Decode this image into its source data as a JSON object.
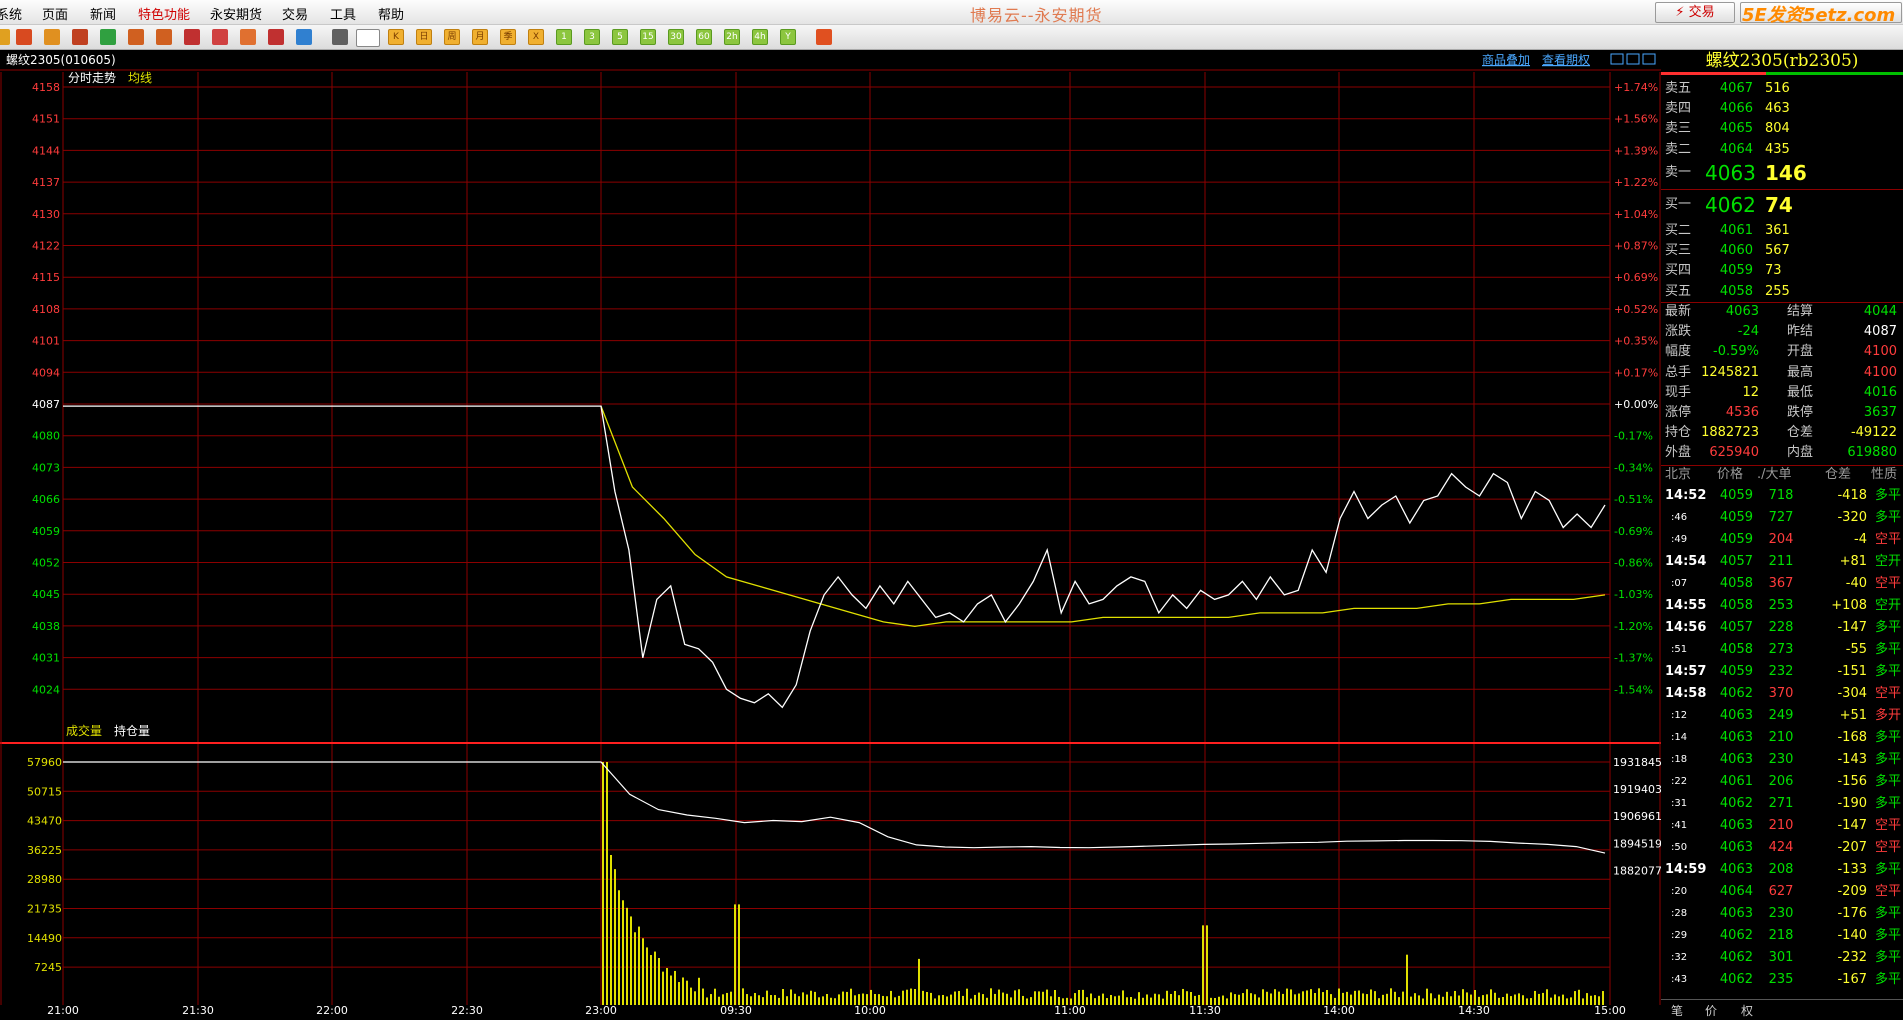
{
  "menu": {
    "items": [
      "系统",
      "页面",
      "新闻",
      "特色功能",
      "永安期货",
      "交易",
      "工具",
      "帮助"
    ],
    "highlight_index": 3
  },
  "app_title": "博易云--永安期货",
  "trade_button": "⚡ 交易",
  "watermark": "5E发资5etz.com",
  "toolbar": {
    "icons": [
      "home-icon",
      "folder-icon",
      "news-icon",
      "refresh-icon",
      "zoom-in-icon",
      "zoom-out-icon",
      "window-icon",
      "draw-icon",
      "tool-icon",
      "filter-icon",
      "new-icon",
      "table-icon",
      "chart-icon",
      "kline-icon",
      "day-icon",
      "week-icon",
      "month-icon",
      "quarter-icon",
      "year-icon",
      "1min-icon",
      "3min-icon",
      "5min-icon",
      "15min-icon",
      "30min-icon",
      "60min-icon",
      "2h-icon",
      "4h-icon",
      "calc-icon"
    ],
    "labels": {
      "day": "日",
      "week": "周",
      "month": "月",
      "quarter": "季",
      "year": "年",
      "x": "X",
      "m1": "1",
      "m3": "3",
      "m5": "5",
      "m15": "15",
      "m30": "30",
      "m60": "60",
      "h2": "2h",
      "h4": "4h",
      "y": "Y"
    }
  },
  "chart": {
    "symbol_header": "螺纹2305(010605)",
    "links": [
      "商品叠加",
      "查看期权"
    ],
    "price_panel": {
      "title": "分时走势",
      "ma_label": "均线"
    },
    "volume_panel": {
      "title": "成交量",
      "oi_label": "持仓量"
    },
    "colors": {
      "price_line": "#ffffff",
      "avg_line": "#e0e000",
      "grid": "#8b0000",
      "volume_bars": "#e0e000",
      "up": "#ff3c3c",
      "down": "#00e000"
    }
  },
  "chart_data": {
    "type": "line",
    "price_axis_left": [
      "4158",
      "4151",
      "4144",
      "4137",
      "4130",
      "4122",
      "4115",
      "4108",
      "4101",
      "4094",
      "4087",
      "4080",
      "4073",
      "4066",
      "4059",
      "4052",
      "4045",
      "4038",
      "4031",
      "4024"
    ],
    "price_axis_right": [
      "+1.74%",
      "+1.56%",
      "+1.39%",
      "+1.22%",
      "+1.04%",
      "+0.87%",
      "+0.69%",
      "+0.52%",
      "+0.35%",
      "+0.17%",
      "+0.00%",
      "-0.17%",
      "-0.34%",
      "-0.51%",
      "-0.69%",
      "-0.86%",
      "-1.03%",
      "-1.20%",
      "-1.37%",
      "-1.54%"
    ],
    "prev_settle": 4087,
    "volume_axis_left": [
      "57960",
      "50715",
      "43470",
      "36225",
      "28980",
      "21735",
      "14490",
      "7245"
    ],
    "oi_axis_right": [
      "1931845",
      "1919403",
      "1906961",
      "1894519",
      "1882077"
    ],
    "time_labels": [
      "21:00",
      "21:30",
      "22:00",
      "22:30",
      "23:00",
      "09:30",
      "10:00",
      "11:00",
      "11:30",
      "14:00",
      "14:30",
      "15:00"
    ],
    "price_series": [
      4087,
      4087,
      4068,
      4055,
      4031,
      4044,
      4047,
      4034,
      4033,
      4030,
      4024,
      4022,
      4021,
      4023,
      4020,
      4025,
      4037,
      4045,
      4049,
      4045,
      4042,
      4047,
      4043,
      4048,
      4044,
      4040,
      4041,
      4039,
      4043,
      4045,
      4039,
      4043,
      4048,
      4055,
      4041,
      4048,
      4043,
      4044,
      4047,
      4049,
      4048,
      4041,
      4045,
      4042,
      4046,
      4044,
      4045,
      4048,
      4044,
      4049,
      4045,
      4046,
      4055,
      4050,
      4062,
      4068,
      4062,
      4065,
      4067,
      4061,
      4066,
      4067,
      4072,
      4069,
      4067,
      4072,
      4070,
      4062,
      4068,
      4066,
      4060,
      4063,
      4060,
      4065
    ],
    "avg_series": [
      4087,
      4069,
      4062,
      4054,
      4049,
      4047,
      4045,
      4043,
      4041,
      4039,
      4038,
      4039,
      4039,
      4039,
      4039,
      4039,
      4040,
      4040,
      4040,
      4040,
      4040,
      4041,
      4041,
      4041,
      4042,
      4042,
      4042,
      4043,
      4043,
      4044,
      4044,
      4044,
      4045
    ],
    "oi_series": [
      1931845,
      1931845,
      1917000,
      1910000,
      1907500,
      1906000,
      1904000,
      1905000,
      1904500,
      1906500,
      1904000,
      1897500,
      1893800,
      1892800,
      1892500,
      1892800,
      1893000,
      1892600,
      1892500,
      1892800,
      1893200,
      1893600,
      1894000,
      1894200,
      1894500,
      1894800,
      1895000,
      1895500,
      1895600,
      1895800,
      1895800,
      1895700,
      1895400,
      1894600,
      1894000,
      1893000,
      1890000
    ]
  },
  "quote": {
    "title": "螺纹2305(rb2305)",
    "asks": [
      {
        "label": "卖五",
        "price": "4067",
        "vol": "516"
      },
      {
        "label": "卖四",
        "price": "4066",
        "vol": "463"
      },
      {
        "label": "卖三",
        "price": "4065",
        "vol": "804"
      },
      {
        "label": "卖二",
        "price": "4064",
        "vol": "435"
      }
    ],
    "ask1": {
      "label": "卖一",
      "price": "4063",
      "vol": "146"
    },
    "bid1": {
      "label": "买一",
      "price": "4062",
      "vol": "74"
    },
    "bids": [
      {
        "label": "买二",
        "price": "4061",
        "vol": "361"
      },
      {
        "label": "买三",
        "price": "4060",
        "vol": "567"
      },
      {
        "label": "买四",
        "price": "4059",
        "vol": "73"
      },
      {
        "label": "买五",
        "price": "4058",
        "vol": "255"
      }
    ],
    "stats": [
      [
        "最新",
        "4063",
        "grn",
        "结算",
        "4044",
        "grn"
      ],
      [
        "涨跌",
        "-24",
        "grn",
        "昨结",
        "4087",
        "wht"
      ],
      [
        "幅度",
        "-0.59%",
        "grn",
        "开盘",
        "4100",
        "red"
      ],
      [
        "总手",
        "1245821",
        "yel",
        "最高",
        "4100",
        "red"
      ],
      [
        "现手",
        "12",
        "yel",
        "最低",
        "4016",
        "grn"
      ],
      [
        "涨停",
        "4536",
        "red",
        "跌停",
        "3637",
        "grn"
      ],
      [
        "持仓",
        "1882723",
        "yel",
        "仓差",
        "-49122",
        "yel"
      ],
      [
        "外盘",
        "625940",
        "red",
        "内盘",
        "619880",
        "grn"
      ]
    ],
    "tick_header": [
      "北京",
      "价格",
      "./大单",
      "仓差",
      "性质"
    ],
    "ticks": [
      [
        "14:52",
        "4059",
        "718",
        "-418",
        "多平",
        "big"
      ],
      [
        ":46",
        "4059",
        "727",
        "-320",
        "多平",
        "small"
      ],
      [
        ":49",
        "4059",
        "204",
        "-4",
        "空平",
        "small"
      ],
      [
        "14:54",
        "4057",
        "211",
        "+81",
        "空开",
        "big"
      ],
      [
        ":07",
        "4058",
        "367",
        "-40",
        "空平",
        "small"
      ],
      [
        "14:55",
        "4058",
        "253",
        "+108",
        "空开",
        "big"
      ],
      [
        "14:56",
        "4057",
        "228",
        "-147",
        "多平",
        "big"
      ],
      [
        ":51",
        "4058",
        "273",
        "-55",
        "多平",
        "small"
      ],
      [
        "14:57",
        "4059",
        "232",
        "-151",
        "多平",
        "big"
      ],
      [
        "14:58",
        "4062",
        "370",
        "-304",
        "空平",
        "big"
      ],
      [
        ":12",
        "4063",
        "249",
        "+51",
        "多开",
        "small"
      ],
      [
        ":14",
        "4063",
        "210",
        "-168",
        "多平",
        "small"
      ],
      [
        ":18",
        "4063",
        "230",
        "-143",
        "多平",
        "small"
      ],
      [
        ":22",
        "4061",
        "206",
        "-156",
        "多平",
        "small"
      ],
      [
        ":31",
        "4062",
        "271",
        "-190",
        "多平",
        "small"
      ],
      [
        ":41",
        "4063",
        "210",
        "-147",
        "空平",
        "small"
      ],
      [
        ":50",
        "4063",
        "424",
        "-207",
        "空平",
        "small"
      ],
      [
        "14:59",
        "4063",
        "208",
        "-133",
        "多平",
        "big"
      ],
      [
        ":20",
        "4064",
        "627",
        "-209",
        "空平",
        "small"
      ],
      [
        ":28",
        "4063",
        "230",
        "-176",
        "多平",
        "small"
      ],
      [
        ":29",
        "4062",
        "218",
        "-140",
        "多平",
        "small"
      ],
      [
        ":32",
        "4062",
        "301",
        "-232",
        "多平",
        "small"
      ],
      [
        ":43",
        "4062",
        "235",
        "-167",
        "多平",
        "small"
      ]
    ],
    "bottom_tabs": [
      "笔",
      "价",
      "权"
    ]
  }
}
